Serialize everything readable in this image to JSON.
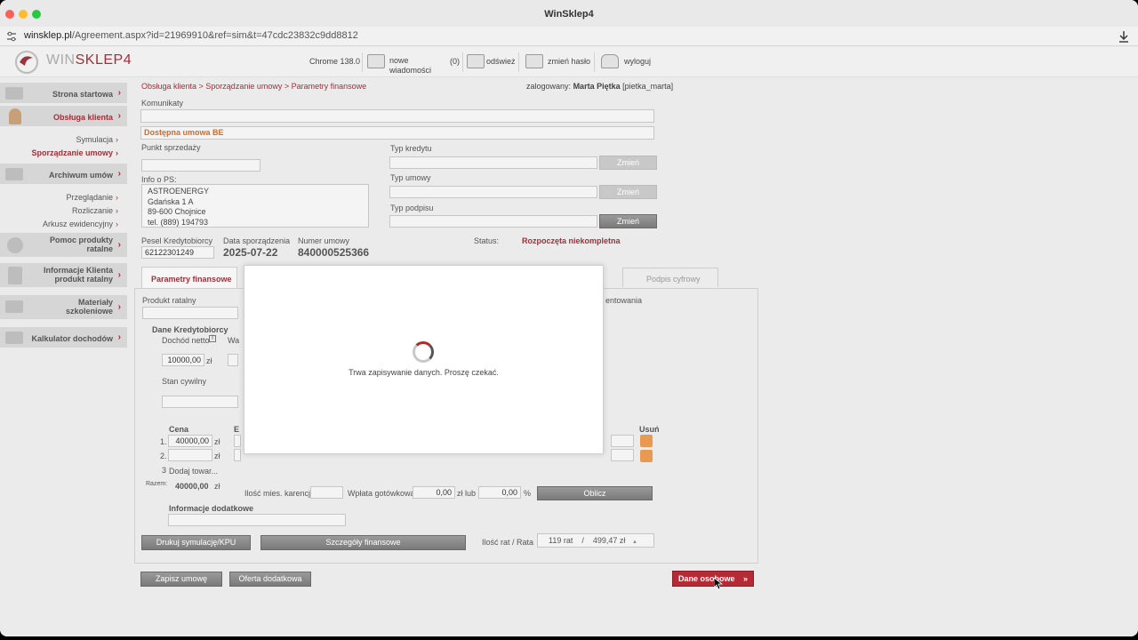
{
  "window": {
    "title": "WinSklep4"
  },
  "browser": {
    "url_host": "winsklep.pl",
    "url_path": "/Agreement.aspx?id=21969910&ref=sim&t=47cdc23832c9dd8812"
  },
  "header": {
    "logo_win": "WIN",
    "logo_sklep": "SKLEP4",
    "browser_version": "Chrome 138.0",
    "messages_label_1": "nowe",
    "messages_label_2": "wiadomości",
    "messages_count": "(0)",
    "refresh_label": "odśwież",
    "change_password_label": "zmień hasło",
    "logout_label": "wyloguj"
  },
  "sidebar": {
    "items": [
      {
        "label": "Strona startowa"
      },
      {
        "label": "Obsługa klienta"
      },
      {
        "label": "Archiwum umów"
      },
      {
        "label_1": "Pomoc produkty",
        "label_2": "ratalne"
      },
      {
        "label_1": "Informacje Klienta",
        "label_2": "produkt ratalny"
      },
      {
        "label_1": "Materiały",
        "label_2": "szkoleniowe"
      },
      {
        "label": "Kalkulator dochodów"
      }
    ],
    "sub_obsluga": [
      "Symulacja",
      "Sporządzanie umowy"
    ],
    "sub_archiwum": [
      "Przeglądanie",
      "Rozliczanie",
      "Arkusz ewidencyjny"
    ],
    "arrow": "›"
  },
  "breadcrumb": "Obsługa klienta > Sporządzanie umowy > Parametry finansowe",
  "logged_in": {
    "prefix": "zalogowany:",
    "name": "Marta Piętka",
    "login": "[pietka_marta]"
  },
  "form": {
    "komunikaty_label": "Komunikaty",
    "available_agreement": "Dostępna umowa BE",
    "punkt_sprzedazy_label": "Punkt sprzedaży",
    "info_ps_label": "Info o PS:",
    "info_ps_lines": [
      "ASTROENERGY",
      "Gdańska  1 A",
      "89-600  Chojnice",
      "tel. (889) 194793"
    ],
    "typ_kredytu_label": "Typ kredytu",
    "typ_umowy_label": "Typ umowy",
    "typ_podpisu_label": "Typ podpisu",
    "zmien": "Zmień",
    "pesel_label": "Pesel Kredytobiorcy",
    "pesel_value": "62122301249",
    "data_label": "Data sporządzenia",
    "data_value": "2025-07-22",
    "numer_label": "Numer umowy",
    "numer_value": "840000525366",
    "status_label": "Status:",
    "status_value": "Rozpoczęta niekompletna"
  },
  "tabs": {
    "active": "Parametry finansowe",
    "signature": "Podpis cyfrowy"
  },
  "panel": {
    "produkt_ratalny": "Produkt ratalny",
    "udokumentowania_partial": "entowania",
    "dane_kredytobiorcy": "Dane Kredytobiorcy",
    "dochod_netto": "Dochód netto",
    "info_icon": "i",
    "wa_partial": "Wa",
    "dochod_value": "10000,00",
    "zl": "zł",
    "stan_cywilny": "Stan cywilny",
    "cena": "Cena",
    "e_partial": "E",
    "usun": "Usuń",
    "row1_num": "1.",
    "row1_price": "40000,00",
    "row2_num": "2.",
    "row3_num": "3",
    "dodaj_towar": "Dodaj towar...",
    "razem": "Razem:",
    "razem_value": "40000,00",
    "karencja_label": "Ilość mies. karencji",
    "wplata_label": "Wpłata gotówkowa",
    "wplata_value": "0,00",
    "zl_lub": "zł lub",
    "procent_value": "0,00",
    "procent": "%",
    "oblicz": "Oblicz",
    "informacje_dodatkowe": "Informacje dodatkowe",
    "drukuj": "Drukuj symulację/KPU",
    "szczegoly": "Szczegóły finansowe",
    "ilosc_rat_label": "Ilość rat / Rata",
    "ilosc_rat_value": "119 rat",
    "slash": "/",
    "rata_value": "499,47 zł",
    "up_arrow": "▲"
  },
  "bottom": {
    "zapisz": "Zapisz umowę",
    "oferta": "Oferta dodatkowa",
    "dane_osobowe": "Dane osobowe",
    "dane_arrow": "»"
  },
  "modal": {
    "message": "Trwa zapisywanie danych. Proszę czekać."
  },
  "colors": {
    "brand_red": "#a0303a",
    "accent_orange": "#d46a2a",
    "status_red": "#a0303a"
  }
}
